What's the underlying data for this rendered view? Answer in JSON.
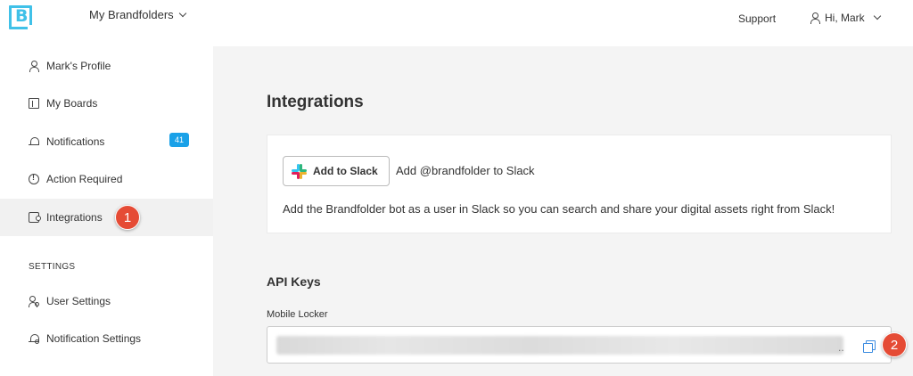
{
  "header": {
    "brand_letter": "B",
    "brand_menu": "My Brandfolders",
    "support": "Support",
    "user_greeting": "Hi, Mark"
  },
  "sidebar": {
    "items": [
      {
        "label": "Mark's Profile",
        "icon": "user-icon"
      },
      {
        "label": "My Boards",
        "icon": "board-icon"
      },
      {
        "label": "Notifications",
        "icon": "bell-icon",
        "badge": "41"
      },
      {
        "label": "Action Required",
        "icon": "alert-circle-icon"
      },
      {
        "label": "Integrations",
        "icon": "puzzle-icon",
        "active": true
      }
    ],
    "settings_heading": "SETTINGS",
    "settings_items": [
      {
        "label": "User Settings",
        "icon": "user-settings-icon"
      },
      {
        "label": "Notification Settings",
        "icon": "bell-settings-icon"
      }
    ]
  },
  "main": {
    "title": "Integrations",
    "slack": {
      "button_label": "Add to Slack",
      "add_text": "Add @brandfolder to Slack",
      "description": "Add the Brandfolder bot as a user in Slack so you can search and share your digital assets right from Slack!"
    },
    "api_keys": {
      "title": "API Keys",
      "field_label": "Mobile Locker",
      "truncation": ".."
    }
  },
  "callouts": [
    "1",
    "2"
  ],
  "colors": {
    "brand": "#40c1e8",
    "badge": "#1aa1e8",
    "callout": "#e54b35",
    "copy_icon": "#3a8be0"
  }
}
